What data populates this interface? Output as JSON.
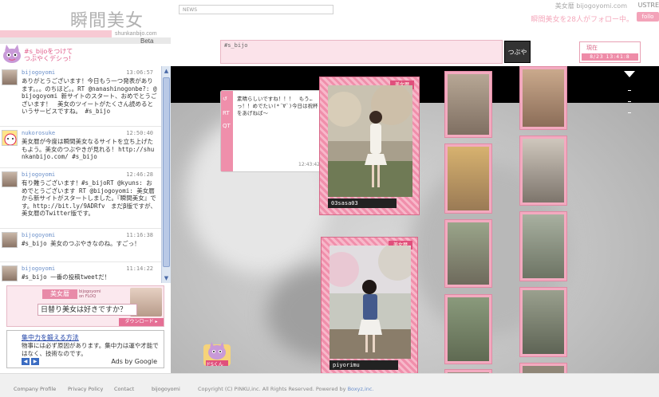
{
  "brand": {
    "logo": "瞬間美女",
    "subdomain": "shunkanbijo.com",
    "beta": "Beta",
    "mascot_text": "#s_bijoをつけて\nつぶやくデシっ!"
  },
  "header": {
    "news_label": "NEWS",
    "site_title": "美女暦 bijogoyomi.com",
    "ustream": "USTRE",
    "follow_text": "瞬間美女を28人がフォロー中。",
    "follow_button": "follo"
  },
  "composer": {
    "value": "#s_bijo",
    "submit": "つぶやく"
  },
  "counter": {
    "label": "現在",
    "value": "8/23 13:41:8"
  },
  "feed": {
    "tweets": [
      {
        "user": "bijogoyomi",
        "time": "13:06:57",
        "body": "ありがとうございます！今日もう一つ発表があります。。。のちほど。。RT @nanashinogonbe?: @bijogoyomi 新サイトのスタート、おめでとうございます！　美女のツイートがたくさん読めるというサービスですね。 #s_bijo"
      },
      {
        "user": "nukorosuke",
        "time": "12:50:40",
        "body": "美女暦が今度は瞬間美女なるサイトを立ち上げたもよう。美女のつぶやきが見れる! http://shunkanbijo.com/ #s_bijo"
      },
      {
        "user": "bijogoyomi",
        "time": "12:46:28",
        "body": "有り難うございます！#s_bijoRT @kyuns: おめでとうございます RT @bijogoyomi: 美女暦から新サイトがスタートしました。『瞬間美女』です。http://bit.ly/9ADRfv　まだβ版ですが、美女暦のTwitter版です。"
      },
      {
        "user": "bijogoyomi",
        "time": "11:16:38",
        "body": "#s_bijo 美女のつぶやきなのね。すごっ！"
      },
      {
        "user": "bijogoyomi",
        "time": "11:14:22",
        "body": "#s_bijo 一番の投稿tweetだ！"
      }
    ]
  },
  "ads": {
    "ad1": {
      "brand": "美女暦",
      "brand_sub": "bijogoyomi\non FLOQ",
      "slogan": "日替り美女は好きですか？",
      "download": "ダウンロード ▸"
    },
    "ad2": {
      "headline": "集中力を鍛える方法",
      "text": "物事には必ず原因があります。集中力は運や才能ではなく、技術なのです。",
      "ads_by": "Ads by Google",
      "prev": "◀",
      "next": "▶"
    }
  },
  "stage": {
    "bubble": {
      "side_labels": [
        "↺",
        "RT",
        "QT"
      ],
      "message": "素晴らしいですね！！！　もう…っ！！めでたい(*´∀`)今日は祝杯をあげねば～",
      "time": "12:43:42"
    },
    "cards": [
      {
        "caption": "03sasa03",
        "badge": "美女暦"
      },
      {
        "caption": "piyorimu",
        "badge": "美女暦"
      }
    ],
    "ds_badge": "ドSくん"
  },
  "footer": {
    "links": [
      "Company Profile",
      "Privacy Policy",
      "Contact",
      "bijogoyomi"
    ],
    "copyright": "Copyright (C) PINKU,inc. All Rights Reserved. Powered by ",
    "powered": "Boxyz,inc."
  },
  "colors": {
    "accent_pink": "#f08fab",
    "link_blue": "#6a8fc9"
  }
}
